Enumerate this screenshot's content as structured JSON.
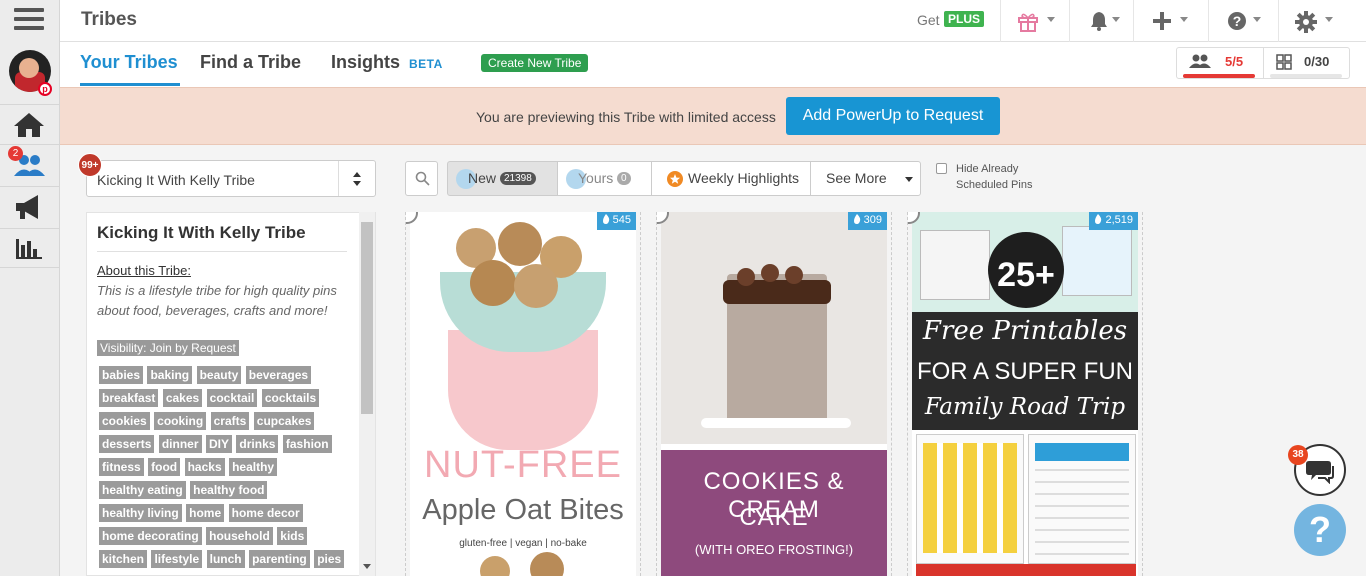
{
  "app": {
    "title": "Tribes"
  },
  "topbar": {
    "get_label": "Get",
    "plus_label": "PLUS"
  },
  "tabs": [
    {
      "label": "Your Tribes"
    },
    {
      "label": "Find a Tribe"
    },
    {
      "label": "Insights"
    }
  ],
  "beta_label": "BETA",
  "create_tribe_label": "Create New Tribe",
  "counters": {
    "members": "5/5",
    "tribes": "0/30"
  },
  "banner": {
    "message": "You are previewing this Tribe with limited access",
    "button_label": "Add PowerUp to Request"
  },
  "left_nav": {
    "notification_count": "2"
  },
  "tribe_select": {
    "badge": "99+",
    "value": "Kicking It With Kelly Tribe"
  },
  "tribe_info": {
    "name": "Kicking It With Kelly Tribe",
    "about_heading": "About this Tribe:",
    "about": "This is a lifestyle tribe for high quality pins about food, beverages, crafts and more!",
    "visibility": "Visibility: Join by Request",
    "tags": [
      "babies",
      "baking",
      "beauty",
      "beverages",
      "breakfast",
      "cakes",
      "cocktail",
      "cocktails",
      "cookies",
      "cooking",
      "crafts",
      "cupcakes",
      "desserts",
      "dinner",
      "DIY",
      "drinks",
      "fashion",
      "fitness",
      "food",
      "hacks",
      "healthy",
      "healthy eating",
      "healthy food",
      "healthy living",
      "home",
      "home decor",
      "home decorating",
      "household",
      "kids",
      "kitchen",
      "lifestyle",
      "lunch",
      "parenting",
      "pies"
    ]
  },
  "filters": {
    "new_label": "New",
    "new_count": "21398",
    "yours_label": "Yours",
    "yours_count": "0",
    "highlights_label": "Weekly Highlights",
    "more_label": "See More",
    "hide_label": "Hide Already Scheduled Pins"
  },
  "pins": [
    {
      "score": "545",
      "title_top": "NUT-FREE",
      "title_bottom": "Apple Oat Bites",
      "subtitle": "gluten-free | vegan | no-bake"
    },
    {
      "score": "309",
      "title_top": "COOKIES & CREAM",
      "title_bottom": "CAKE",
      "subtitle": "(WITH OREO FROSTING!)"
    },
    {
      "score": "2,519",
      "badge_text": "25+",
      "title_top": "Free Printables",
      "title_mid": "FOR A SUPER FUN",
      "title_bottom": "Family Road Trip"
    }
  ],
  "chat": {
    "badge": "38"
  },
  "help_label": "?",
  "colors": {
    "accent": "#1f8fd1",
    "banner": "#f5dcd0",
    "banner_button": "#1895d3",
    "create_button": "#2e9e4f",
    "tag": "#9b9b9b",
    "counter_red": "#e53935"
  }
}
